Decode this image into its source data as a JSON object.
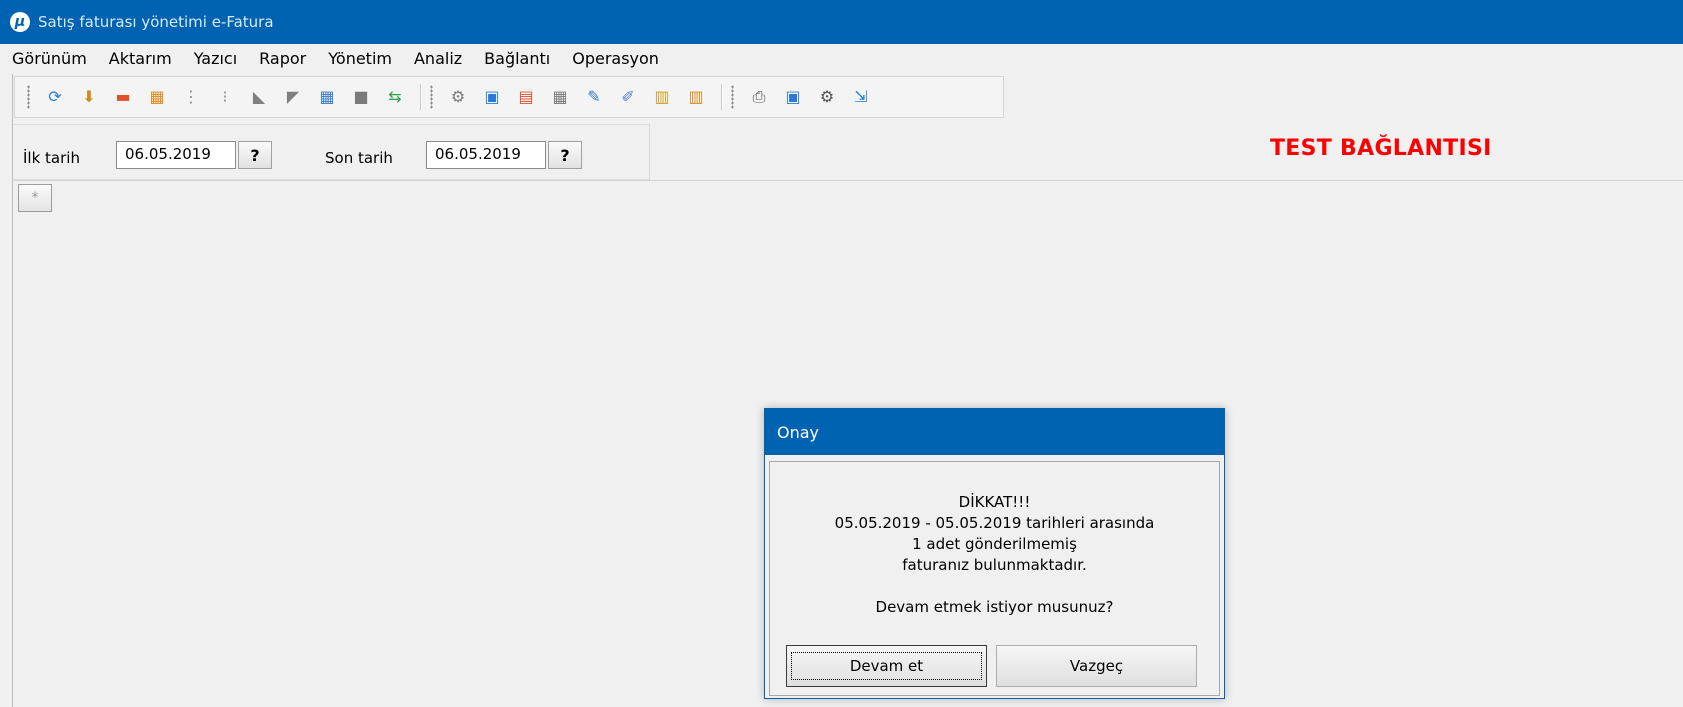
{
  "window": {
    "title": "Satış faturası yönetimi e-Fatura",
    "logo_letter": "μ"
  },
  "menu": [
    "Görünüm",
    "Aktarım",
    "Yazıcı",
    "Rapor",
    "Yönetim",
    "Analiz",
    "Bağlantı",
    "Operasyon"
  ],
  "toolbar": {
    "group1": [
      {
        "icon": "refresh-icon",
        "glyph": "⟳",
        "color": "#2b7bd6"
      },
      {
        "icon": "download-add-icon",
        "glyph": "⬇",
        "color": "#d08a12"
      },
      {
        "icon": "card-icon",
        "glyph": "▬",
        "color": "#e0502a"
      },
      {
        "icon": "grid-orange-icon",
        "glyph": "▦",
        "color": "#e08a1a"
      },
      {
        "icon": "tree-icon",
        "glyph": "⋮",
        "color": "#8a8a8a"
      },
      {
        "icon": "tree-small-icon",
        "glyph": "⁝",
        "color": "#8a8a8a"
      },
      {
        "icon": "tag-icon",
        "glyph": "◣",
        "color": "#808080"
      },
      {
        "icon": "tag-flag-icon",
        "glyph": "◤",
        "color": "#808080"
      },
      {
        "icon": "grid-check-icon",
        "glyph": "▦",
        "color": "#3a7ad0"
      },
      {
        "icon": "square-gray-icon",
        "glyph": "■",
        "color": "#7a7a7a"
      },
      {
        "icon": "swap-icon",
        "glyph": "⇆",
        "color": "#2ea24a"
      }
    ],
    "group2": [
      {
        "icon": "settings-search-icon",
        "glyph": "⚙",
        "color": "#7a7a7a"
      },
      {
        "icon": "window-search-icon",
        "glyph": "▣",
        "color": "#2b7bd6"
      },
      {
        "icon": "calendar-icon",
        "glyph": "▤",
        "color": "#e0502a"
      },
      {
        "icon": "table-icon",
        "glyph": "▦",
        "color": "#7a7a7a"
      },
      {
        "icon": "edit-icon",
        "glyph": "✎",
        "color": "#2b7bd6"
      },
      {
        "icon": "attach-icon",
        "glyph": "✐",
        "color": "#5a7ad0"
      },
      {
        "icon": "clipboard-icon",
        "glyph": "▥",
        "color": "#d0a020"
      },
      {
        "icon": "paste-icon",
        "glyph": "▥",
        "color": "#e08a1a"
      }
    ],
    "group3": [
      {
        "icon": "printer-icon",
        "glyph": "⎙",
        "color": "#555555"
      },
      {
        "icon": "print-preview-icon",
        "glyph": "▣",
        "color": "#2b7bd6"
      },
      {
        "icon": "print-settings-icon",
        "glyph": "⚙",
        "color": "#555555"
      },
      {
        "icon": "export-icon",
        "glyph": "⇲",
        "color": "#2b7bd6"
      }
    ]
  },
  "filters": {
    "start_label": "İlk tarih",
    "start_value": "06.05.2019",
    "end_label": "Son tarih",
    "end_value": "06.05.2019",
    "help_label": "?"
  },
  "banner": {
    "text": "TEST BAĞLANTISI",
    "color": "#ff0000"
  },
  "star_button": "*",
  "dialog": {
    "title": "Onay",
    "lines": [
      "DİKKAT!!!",
      "05.05.2019 - 05.05.2019 tarihleri arasında",
      "1 adet gönderilmemiş",
      "faturanız bulunmaktadır.",
      "",
      "Devam etmek istiyor musunuz?"
    ],
    "continue_label": "Devam et",
    "cancel_label": "Vazgeç"
  },
  "colors": {
    "titlebar": "#0063b1"
  }
}
